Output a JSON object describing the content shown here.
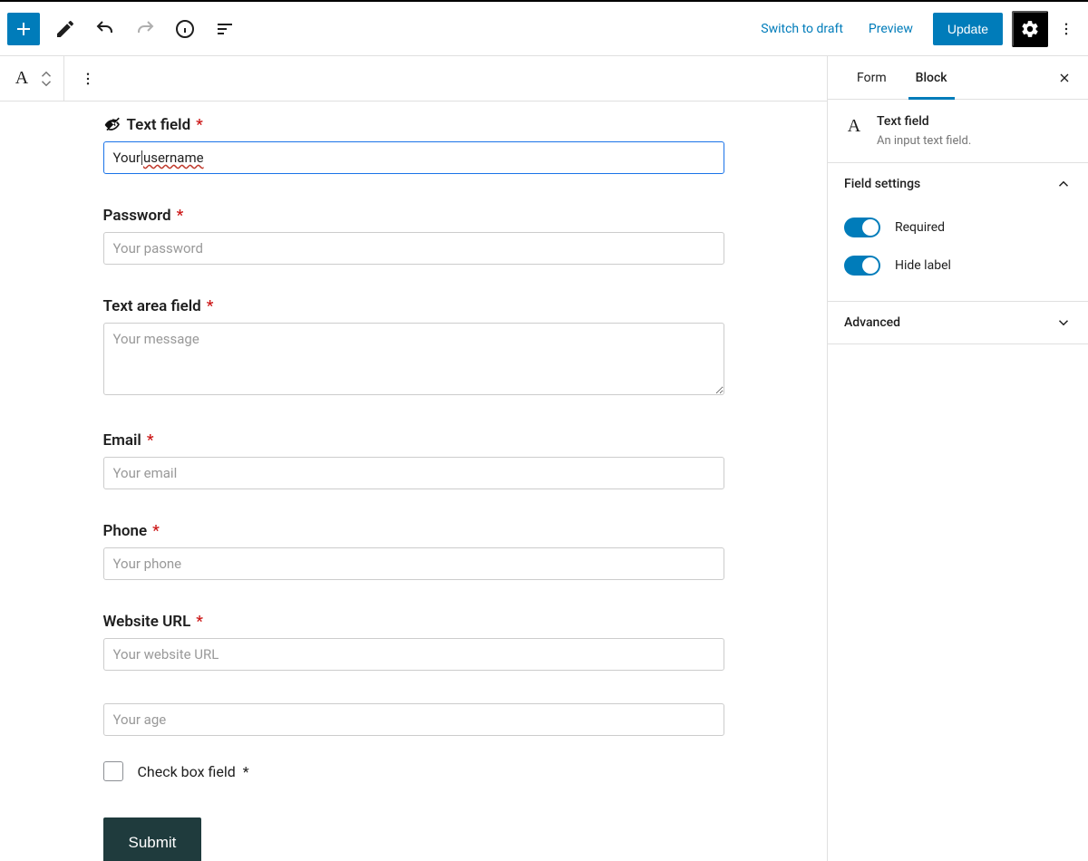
{
  "header": {
    "switch_to_draft": "Switch to draft",
    "preview": "Preview",
    "update": "Update"
  },
  "block_toolbar": {
    "block_glyph": "A"
  },
  "form": {
    "text_field_label": "Text field",
    "text_field_value_pre": "Your",
    "text_field_value_post": "username",
    "password_label": "Password",
    "password_placeholder": "Your password",
    "textarea_label": "Text area field",
    "textarea_placeholder": "Your message",
    "email_label": "Email",
    "email_placeholder": "Your email",
    "phone_label": "Phone",
    "phone_placeholder": "Your phone",
    "url_label": "Website URL",
    "url_placeholder": "Your website URL",
    "age_placeholder": "Your age",
    "checkbox_label": "Check box field",
    "submit_label": "Submit",
    "required_mark": "*"
  },
  "sidebar": {
    "tab_form": "Form",
    "tab_block": "Block",
    "block_icon": "A",
    "block_title": "Text field",
    "block_desc": "An input text field.",
    "section_field_settings": "Field settings",
    "toggle_required": "Required",
    "toggle_hide_label": "Hide label",
    "section_advanced": "Advanced"
  }
}
